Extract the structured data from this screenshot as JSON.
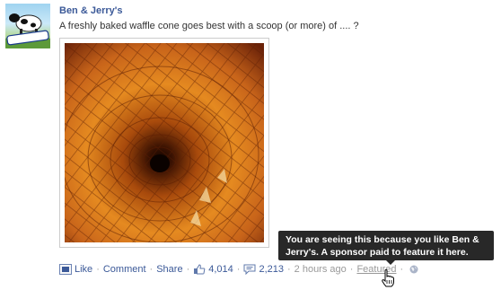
{
  "post": {
    "page_name": "Ben & Jerry's",
    "text": "A freshly baked waffle cone goes best with a scoop (or more) of .... ?",
    "avatar_logo_text": "BEN&JERRY'S",
    "photo_icon": "waffle-cone-photo"
  },
  "actions": {
    "like": "Like",
    "comment": "Comment",
    "share": "Share",
    "likes_count": "4,014",
    "comments_count": "2,213",
    "time": "2 hours ago",
    "featured": "Featured",
    "separator": "·"
  },
  "tooltip": {
    "text": "You are seeing this because you like Ben & Jerry's. A sponsor paid to feature it here."
  },
  "colors": {
    "link": "#3b5998",
    "meta": "#999999",
    "tooltip_bg": "#282828"
  }
}
